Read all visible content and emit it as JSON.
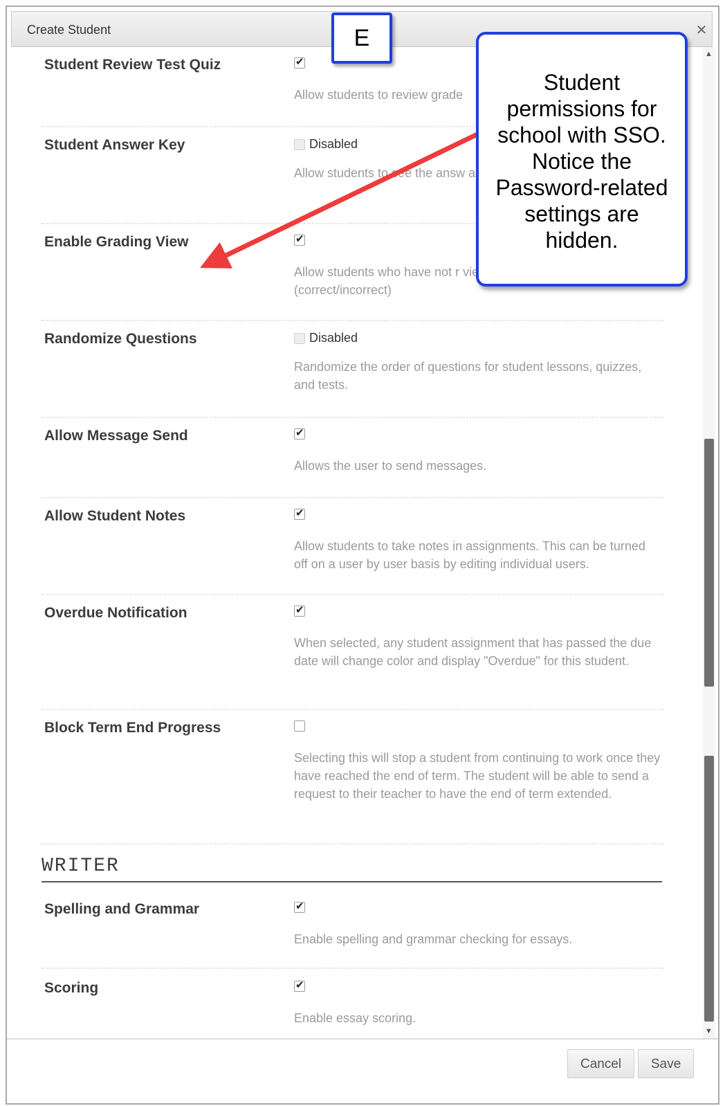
{
  "dialog": {
    "title": "Create Student",
    "close_icon": "close-icon"
  },
  "rows": [
    {
      "label": "Student Review Test Quiz",
      "state": "checked",
      "state_text": "",
      "description": "Allow students to review grade"
    },
    {
      "label": "Student Answer Key",
      "state": "disabled",
      "state_text": "Disabled",
      "description": "Allow students to see the answ assignments."
    },
    {
      "label": "Enable Grading View",
      "state": "checked",
      "state_text": "",
      "description": "Allow students who have not r view performance (correct/incorrect)"
    },
    {
      "label": "Randomize Questions",
      "state": "disabled",
      "state_text": "Disabled",
      "description": "Randomize the order of questions for student lessons, quizzes, and tests."
    },
    {
      "label": "Allow Message Send",
      "state": "checked",
      "state_text": "",
      "description": "Allows the user to send messages."
    },
    {
      "label": "Allow Student Notes",
      "state": "checked",
      "state_text": "",
      "description": "Allow students to take notes in assignments. This can be turned off on a user by user basis by editing individual users."
    },
    {
      "label": "Overdue Notification",
      "state": "checked",
      "state_text": "",
      "description": "When selected, any student assignment that has passed the due date will change color and display \"Overdue\" for this student."
    },
    {
      "label": "Block Term End Progress",
      "state": "unchecked",
      "state_text": "",
      "description": "Selecting this will stop a student from continuing to work once they have reached the end of term. The student will be able to send a request to their teacher to have the end of term extended."
    }
  ],
  "writer": {
    "heading": "WRITER",
    "rows": [
      {
        "label": "Spelling and Grammar",
        "state": "checked",
        "state_text": "",
        "description": "Enable spelling and grammar checking for essays."
      },
      {
        "label": "Scoring",
        "state": "checked",
        "state_text": "",
        "description": "Enable essay scoring."
      }
    ]
  },
  "footer": {
    "cancel_label": "Cancel",
    "save_label": "Save"
  },
  "annotations": {
    "badge_text": "E",
    "callout_text": "Student permissions for school with SSO. Notice the Password-related settings are hidden.",
    "accent_color": "#1f3fe0",
    "arrow_color": "#ee3b3b"
  }
}
